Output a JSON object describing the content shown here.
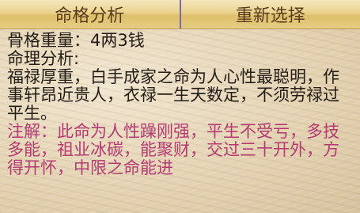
{
  "tabs": {
    "analysis_label": "命格分析",
    "reselect_label": "重新选择"
  },
  "result": {
    "bone_weight": "骨格重量：4两3钱",
    "analysis_heading": "命理分析:",
    "analysis_text": "福禄厚重，白手成家之命为人心性最聪明，作事轩昂近贵人，衣禄一生天数定，不须劳禄过平生。",
    "note_text": "注解：此命为人性躁刚强，平生不受亏，多技多能，祖业冰碳，能聚财，交过三十开外，方得开怀，中限之命能进"
  },
  "colors": {
    "tab_text": "#5b3a1e",
    "body_text": "#231d16",
    "note_text": "#b43a72",
    "tab_divider": "#7c6aa6"
  }
}
